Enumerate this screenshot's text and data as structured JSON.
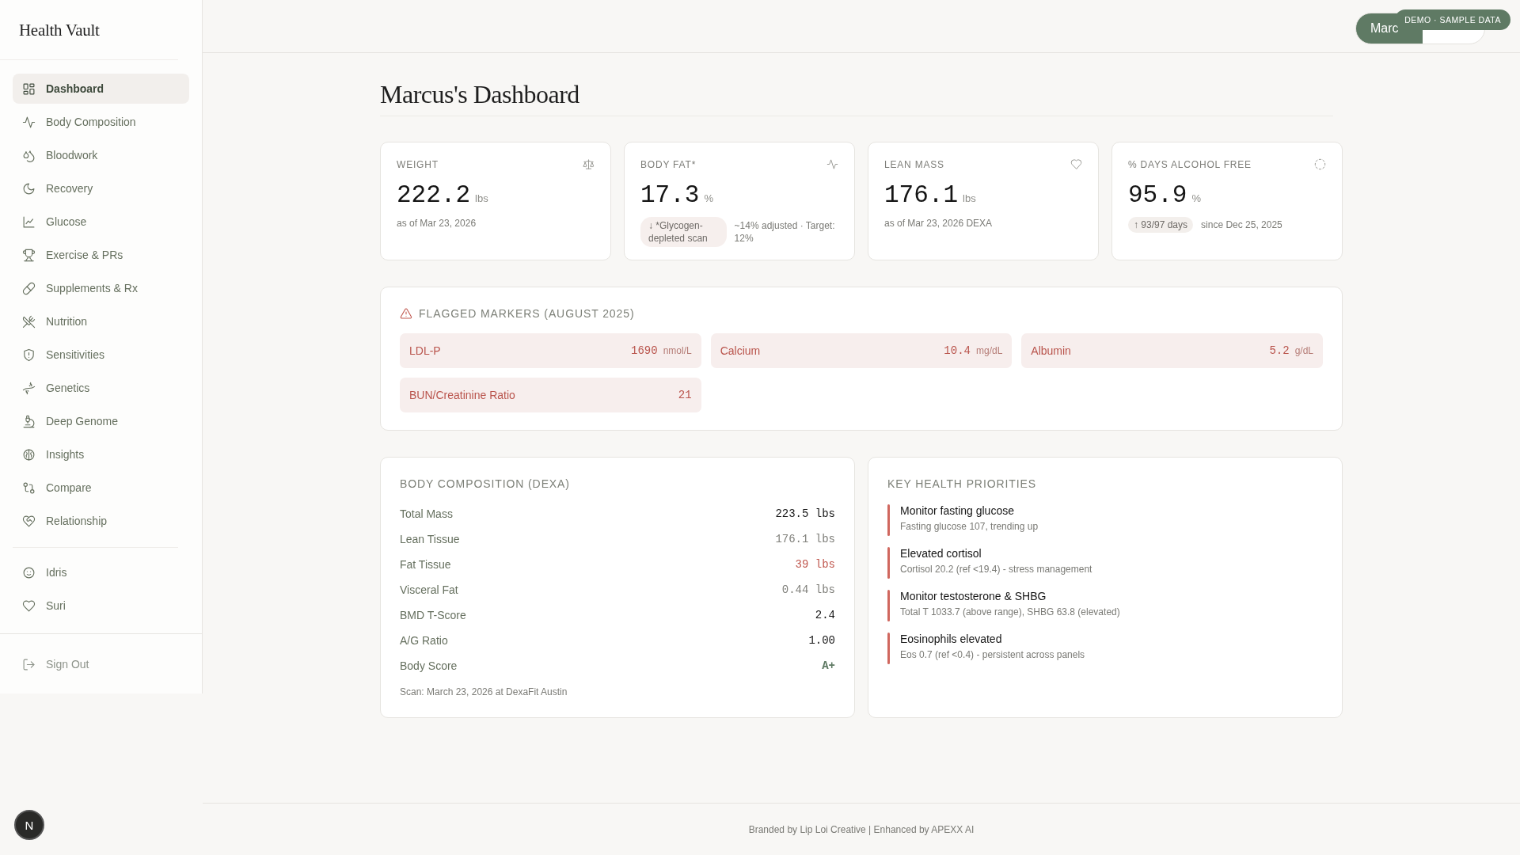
{
  "sidebar": {
    "logo": "Health Vault",
    "nav": [
      {
        "label": "Dashboard",
        "selected": true
      },
      {
        "label": "Body Composition",
        "selected": false
      },
      {
        "label": "Bloodwork",
        "selected": false
      },
      {
        "label": "Recovery",
        "selected": false
      },
      {
        "label": "Glucose",
        "selected": false
      },
      {
        "label": "Exercise & PRs",
        "selected": false
      },
      {
        "label": "Supplements & Rx",
        "selected": false
      },
      {
        "label": "Nutrition",
        "selected": false
      },
      {
        "label": "Sensitivities",
        "selected": false
      },
      {
        "label": "Genetics",
        "selected": false
      },
      {
        "label": "Deep Genome",
        "selected": false
      },
      {
        "label": "Insights",
        "selected": false
      },
      {
        "label": "Compare",
        "selected": false
      },
      {
        "label": "Relationship",
        "selected": false
      }
    ],
    "people": [
      {
        "label": "Idris",
        "selected": false
      },
      {
        "label": "Suri",
        "selected": false
      }
    ],
    "sign_out": "Sign Out"
  },
  "header": {
    "user_button": "Marc",
    "badge": "DEMO · SAMPLE DATA"
  },
  "page_title": "Marcus's Dashboard",
  "stat_cards": [
    {
      "label": "WEIGHT",
      "value": "222.2",
      "unit": "lbs",
      "note": "as of Mar 23, 2026"
    },
    {
      "label": "BODY FAT*",
      "value": "17.3",
      "unit": "%",
      "pill": "↓ *Glycogen-depleted scan",
      "note": "~14% adjusted · Target: 12%"
    },
    {
      "label": "LEAN MASS",
      "value": "176.1",
      "unit": "lbs",
      "note": "as of Mar 23, 2026 DEXA"
    },
    {
      "label": "% DAYS ALCOHOL FREE",
      "value": "95.9",
      "unit": "%",
      "pill": "↑ 93/97 days",
      "note": "since Dec 25, 2025"
    }
  ],
  "flagged": {
    "title": "FLAGGED MARKERS (AUGUST 2025)",
    "markers": [
      {
        "name": "LDL-P",
        "value": "1690",
        "unit": "nmol/L"
      },
      {
        "name": "Calcium",
        "value": "10.4",
        "unit": "mg/dL"
      },
      {
        "name": "Albumin",
        "value": "5.2",
        "unit": "g/dL"
      },
      {
        "name": "BUN/Creatinine Ratio",
        "value": "21"
      }
    ]
  },
  "body_composition": {
    "title": "BODY COMPOSITION (DEXA)",
    "rows": [
      {
        "label": "Total Mass",
        "value": "223.5 lbs",
        "kind": "normal"
      },
      {
        "label": "Lean Tissue",
        "value": "176.1 lbs",
        "kind": "muted"
      },
      {
        "label": "Fat Tissue",
        "value": "39 lbs",
        "kind": "alert"
      },
      {
        "label": "Visceral Fat",
        "value": "0.44 lbs",
        "kind": "muted"
      },
      {
        "label": "BMD T-Score",
        "value": "2.4",
        "kind": "normal"
      },
      {
        "label": "A/G Ratio",
        "value": "1.00",
        "kind": "normal"
      },
      {
        "label": "Body Score",
        "value": "A+",
        "kind": "good"
      }
    ],
    "footnote": "Scan: March 23, 2026 at DexaFit Austin"
  },
  "priorities": {
    "title": "KEY HEALTH PRIORITIES",
    "items": [
      {
        "title": "Monitor fasting glucose",
        "detail": "Fasting glucose 107, trending up"
      },
      {
        "title": "Elevated cortisol",
        "detail": "Cortisol 20.2 (ref <19.4) - stress management"
      },
      {
        "title": "Monitor testosterone & SHBG",
        "detail": "Total T 1033.7 (above range), SHBG 63.8 (elevated)"
      },
      {
        "title": "Eosinophils elevated",
        "detail": "Eos 0.7 (ref <0.4) - persistent across panels"
      }
    ]
  },
  "footer": "Branded by Lip Loi Creative | Enhanced by APEXX AI",
  "assistant_button": "N"
}
